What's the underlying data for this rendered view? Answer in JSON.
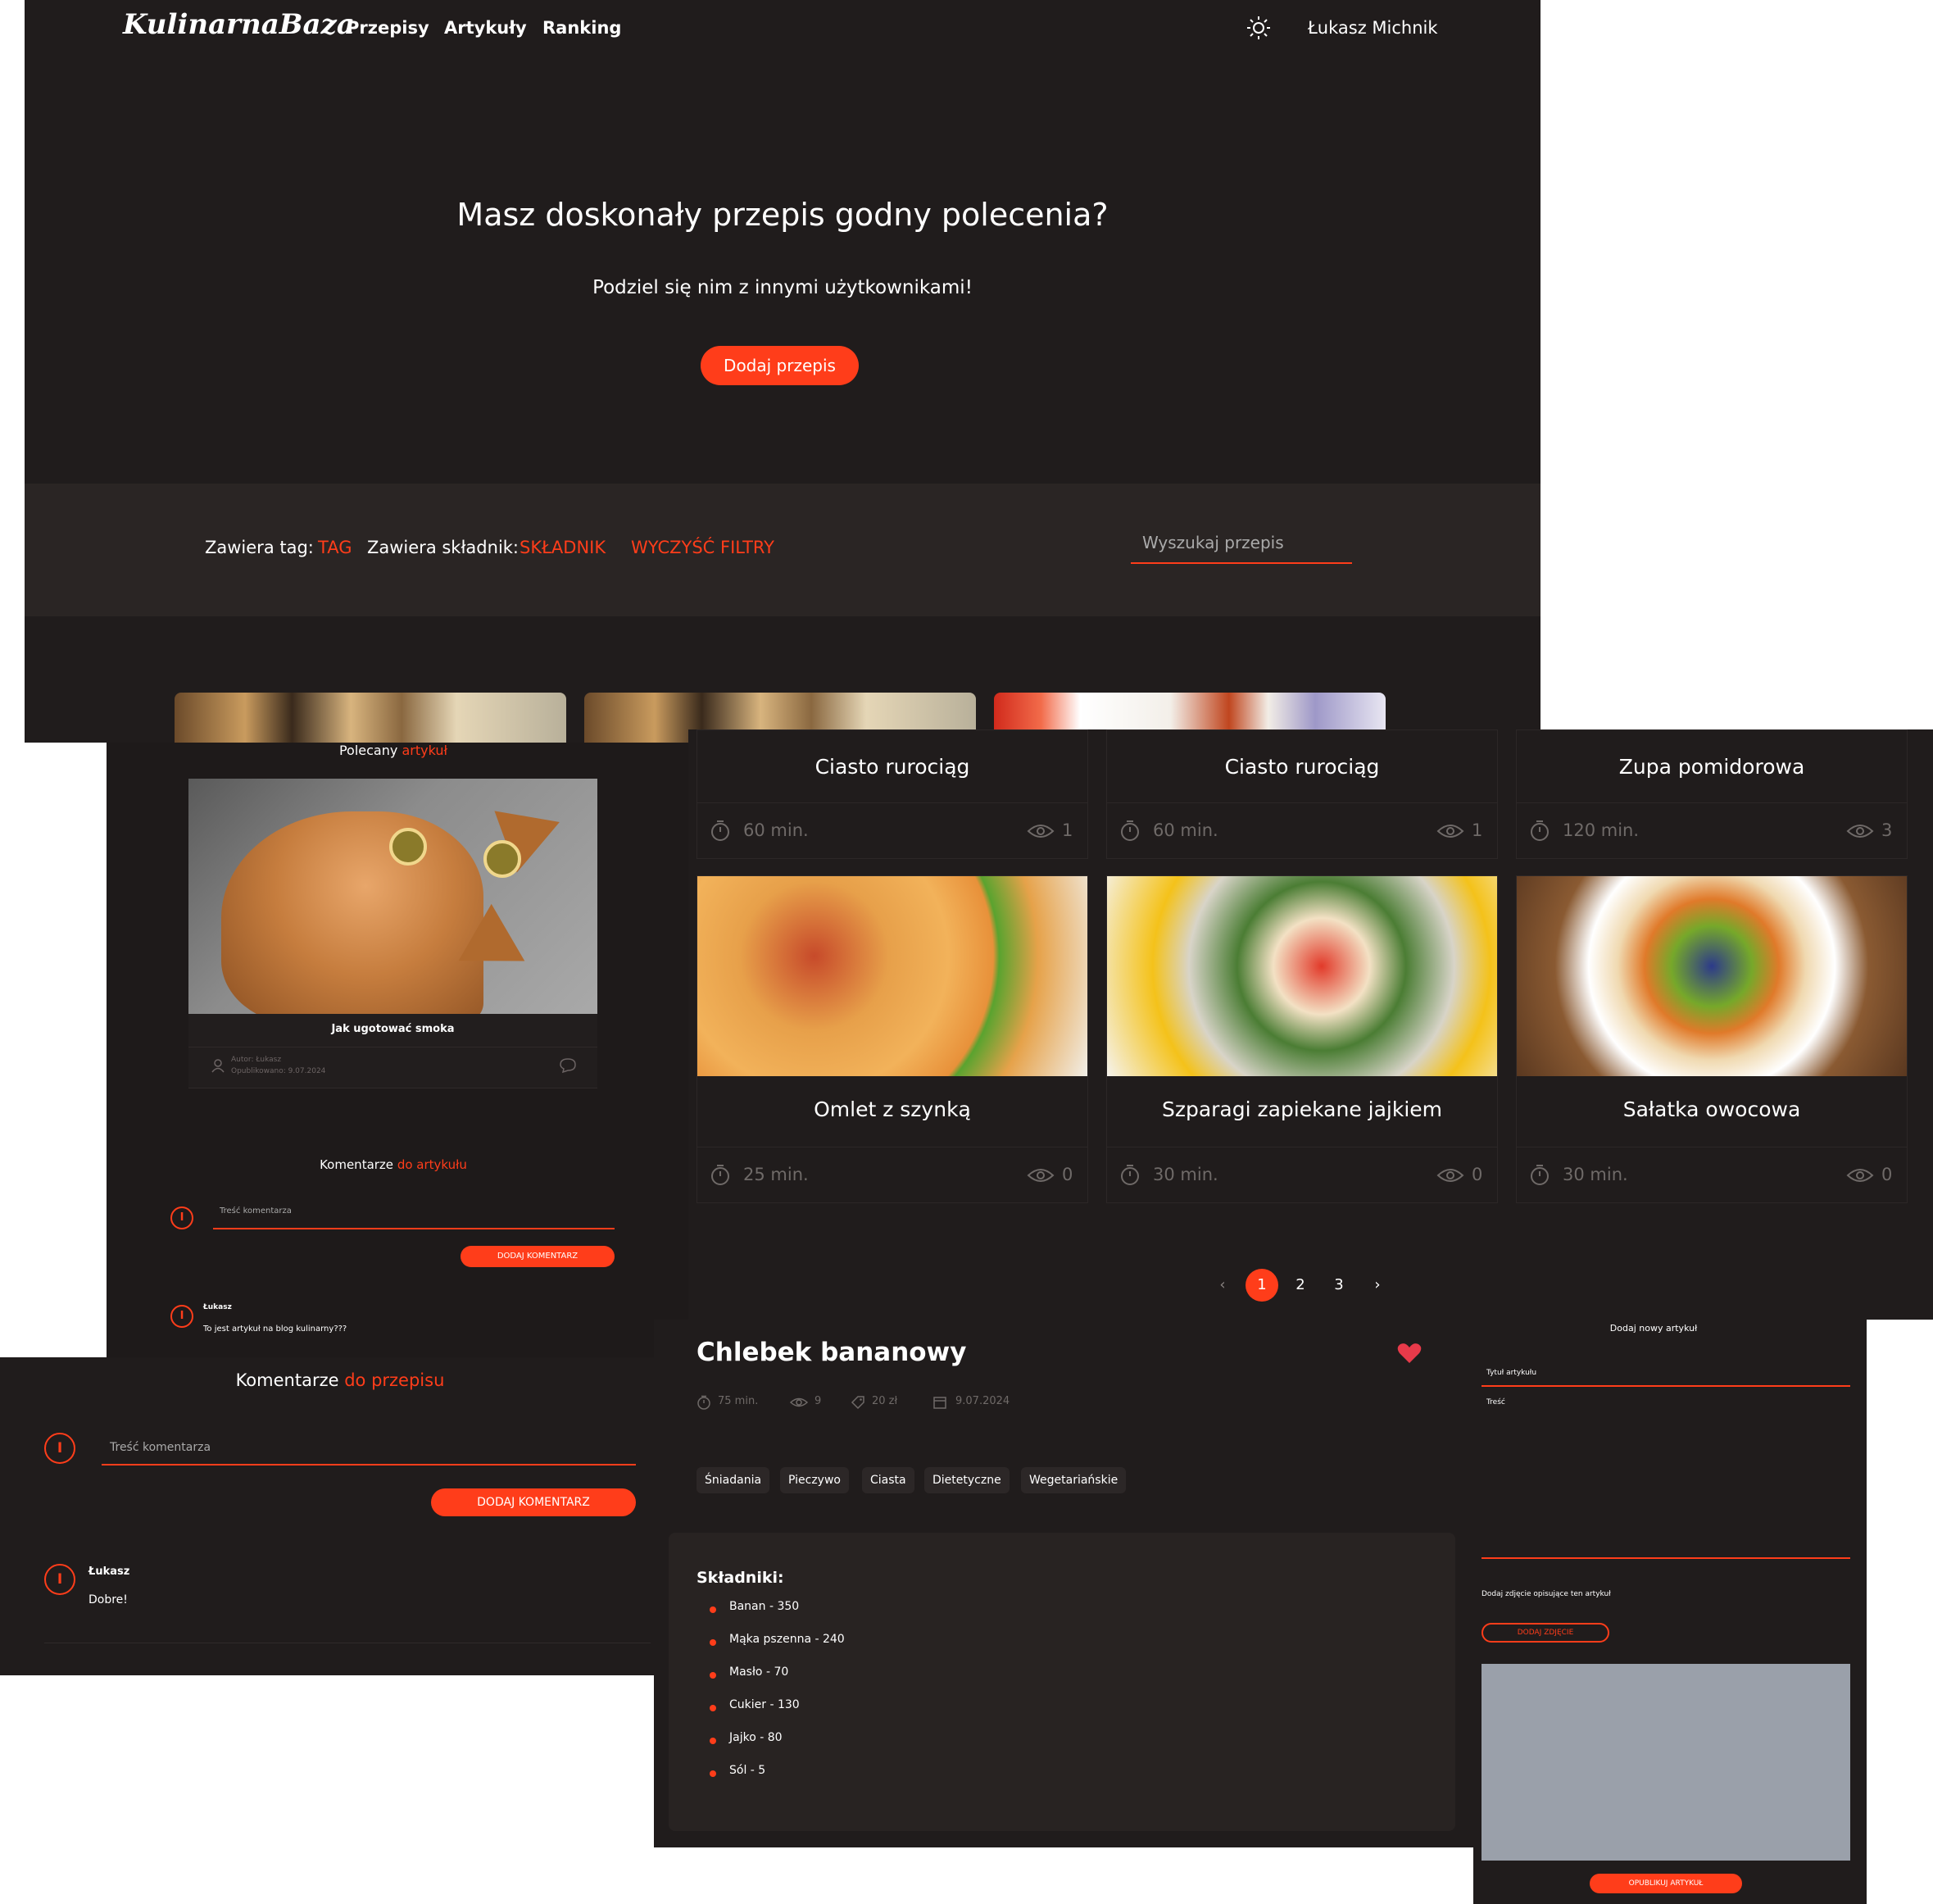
{
  "colors": {
    "accent": "#ff3d1a",
    "background": "#201c1c",
    "card": "#282322"
  },
  "header": {
    "logo": "KulinarnaBaza",
    "nav": [
      "Przepisy",
      "Artykuły",
      "Ranking"
    ],
    "theme_icon": "sun-icon",
    "user": "Łukasz Michnik"
  },
  "hero": {
    "title": "Masz doskonały przepis godny polecenia?",
    "subtitle": "Podziel się nim z innymi użytkownikami!",
    "cta": "Dodaj przepis"
  },
  "filters": {
    "tag_label": "Zawiera tag:",
    "tag_value": "TAG",
    "ingredient_label": "Zawiera składnik:",
    "ingredient_value": "SKŁADNIK",
    "clear": "WYCZYŚĆ FILTRY",
    "search_placeholder": "Wyszukaj przepis"
  },
  "recipes": [
    {
      "name": "Ciasto rurociąg",
      "time": "60 min.",
      "views": "1"
    },
    {
      "name": "Ciasto rurociąg",
      "time": "60 min.",
      "views": "1"
    },
    {
      "name": "Zupa pomidorowa",
      "time": "120 min.",
      "views": "3"
    },
    {
      "name": "Omlet z szynką",
      "time": "25 min.",
      "views": "0"
    },
    {
      "name": "Szparagi zapiekane jajkiem",
      "time": "30 min.",
      "views": "0"
    },
    {
      "name": "Sałatka owocowa",
      "time": "30 min.",
      "views": "0"
    }
  ],
  "pagination": {
    "prev": "‹",
    "pages": [
      "1",
      "2",
      "3"
    ],
    "next": "›"
  },
  "featured_article": {
    "heading_plain": "Polecany",
    "heading_accent": "artykuł",
    "title": "Jak ugotować smoka",
    "author": "Autor: Łukasz",
    "published": "Opublikowano: 9.07.2024"
  },
  "article_comments": {
    "heading_plain": "Komentarze",
    "heading_accent": "do artykułu",
    "placeholder": "Treść komentarza",
    "button": "DODAJ KOMENTARZ",
    "items": [
      {
        "author": "Łukasz",
        "text": "To jest artykuł na blog kulinarny???"
      }
    ]
  },
  "recipe_comments": {
    "heading_plain": "Komentarze",
    "heading_accent": "do przepisu",
    "placeholder": "Treść komentarza",
    "button": "DODAJ KOMENTARZ",
    "items": [
      {
        "author": "Łukasz",
        "text": "Dobre!"
      }
    ]
  },
  "recipe_detail": {
    "title": "Chlebek bananowy",
    "time": "75 min.",
    "views": "9",
    "price": "20 zł",
    "date": "9.07.2024",
    "tags": [
      "Śniadania",
      "Pieczywo",
      "Ciasta",
      "Dietetyczne",
      "Wegetariańskie"
    ],
    "ingredients_heading": "Składniki:",
    "ingredients": [
      "Banan - 350",
      "Mąka pszenna - 240",
      "Masło - 70",
      "Cukier - 130",
      "Jajko - 80",
      "Sól - 5"
    ]
  },
  "new_article": {
    "heading": "Dodaj nowy artykuł",
    "title_placeholder": "Tytuł artykułu",
    "content_placeholder": "Treść",
    "photo_label": "Dodaj zdjęcie opisujące ten artykuł",
    "photo_button": "DODAJ ZDJĘCIE",
    "publish_button": "OPUBLIKUJ ARTYKUŁ"
  }
}
